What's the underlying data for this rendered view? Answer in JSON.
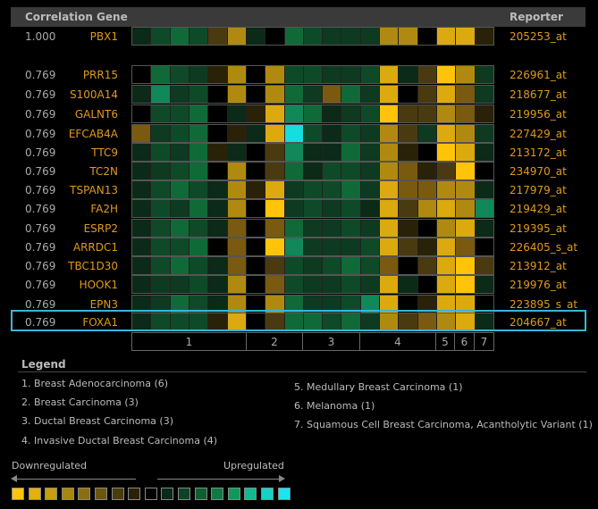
{
  "header": {
    "left": "Correlation Gene",
    "right": "Reporter"
  },
  "palette": {
    "k": "#000000",
    "g1": "#0b2a18",
    "g2": "#0d3a20",
    "g3": "#0f4a28",
    "g4": "#0f6a38",
    "g5": "#10885a",
    "c": "#15dedc",
    "y1": "#2a2208",
    "y2": "#4a3a10",
    "y3": "#7a5a10",
    "y4": "#b08a10",
    "y5": "#dcaa0e",
    "y6": "#ffc40a"
  },
  "rows": [
    {
      "corr": "1.000",
      "gene": "PBX1",
      "reporter": "205253_at",
      "cells": [
        "g1",
        "g3",
        "g4",
        "g3",
        "y2",
        "y4",
        "g1",
        "k",
        "g4",
        "g3",
        "g2",
        "g2",
        "g2",
        "y4",
        "y4",
        "k",
        "y5",
        "y5",
        "y1"
      ]
    },
    {
      "corr": "0.769",
      "gene": "PRR15",
      "reporter": "226961_at",
      "cells": [
        "k",
        "g4",
        "g3",
        "g2",
        "y1",
        "y4",
        "k",
        "y4",
        "g3",
        "g3",
        "g2",
        "g2",
        "g3",
        "y5",
        "g1",
        "y2",
        "y6",
        "y4",
        "g2"
      ]
    },
    {
      "corr": "0.769",
      "gene": "S100A14",
      "reporter": "218677_at",
      "cells": [
        "g1",
        "g5",
        "g2",
        "g3",
        "k",
        "y4",
        "k",
        "y4",
        "g4",
        "g2",
        "y3",
        "g4",
        "g2",
        "y5",
        "k",
        "y2",
        "y5",
        "y3",
        "g2"
      ]
    },
    {
      "corr": "0.769",
      "gene": "GALNT6",
      "reporter": "219956_at",
      "cells": [
        "k",
        "g3",
        "g3",
        "g4",
        "k",
        "g1",
        "y1",
        "y5",
        "g5",
        "g4",
        "g1",
        "g2",
        "g3",
        "y6",
        "y2",
        "y2",
        "y4",
        "y3",
        "y1"
      ]
    },
    {
      "corr": "0.769",
      "gene": "EFCAB4A",
      "reporter": "227429_at",
      "cells": [
        "y3",
        "g2",
        "g3",
        "g4",
        "k",
        "y1",
        "g1",
        "y5",
        "c",
        "g3",
        "g1",
        "g3",
        "g2",
        "y4",
        "y2",
        "g2",
        "y5",
        "y4",
        "g2"
      ]
    },
    {
      "corr": "0.769",
      "gene": "TTC9",
      "reporter": "213172_at",
      "cells": [
        "g1",
        "g3",
        "g2",
        "g4",
        "y1",
        "g1",
        "k",
        "y2",
        "g5",
        "g1",
        "g1",
        "g4",
        "g2",
        "y4",
        "y1",
        "k",
        "y6",
        "y5",
        "g1"
      ]
    },
    {
      "corr": "0.769",
      "gene": "TC2N",
      "reporter": "234970_at",
      "cells": [
        "g1",
        "g2",
        "g3",
        "g4",
        "k",
        "y4",
        "k",
        "y2",
        "g4",
        "g1",
        "g3",
        "g3",
        "g2",
        "y4",
        "y3",
        "y1",
        "y2",
        "y6",
        "k"
      ]
    },
    {
      "corr": "0.769",
      "gene": "TSPAN13",
      "reporter": "217979_at",
      "cells": [
        "g1",
        "g3",
        "g4",
        "g3",
        "g1",
        "y4",
        "y1",
        "y5",
        "g2",
        "g3",
        "g3",
        "g4",
        "g2",
        "y5",
        "y3",
        "y3",
        "y4",
        "y4",
        "g1"
      ]
    },
    {
      "corr": "0.769",
      "gene": "FA2H",
      "reporter": "219429_at",
      "cells": [
        "g1",
        "g3",
        "g2",
        "g4",
        "g1",
        "y4",
        "k",
        "y6",
        "g2",
        "g3",
        "g2",
        "g3",
        "g1",
        "y5",
        "y2",
        "y4",
        "y5",
        "y4",
        "g5"
      ]
    },
    {
      "corr": "0.769",
      "gene": "ESRP2",
      "reporter": "219395_at",
      "cells": [
        "g1",
        "g3",
        "g4",
        "g3",
        "g1",
        "y3",
        "k",
        "y3",
        "g4",
        "g2",
        "g2",
        "g3",
        "g2",
        "y5",
        "y1",
        "k",
        "y4",
        "y5",
        "g1"
      ]
    },
    {
      "corr": "0.769",
      "gene": "ARRDC1",
      "reporter": "226405_s_at",
      "cells": [
        "g1",
        "g3",
        "g3",
        "g4",
        "k",
        "y3",
        "k",
        "y6",
        "g5",
        "g2",
        "g2",
        "g2",
        "g3",
        "y5",
        "y2",
        "y1",
        "y5",
        "y3",
        "k"
      ]
    },
    {
      "corr": "0.769",
      "gene": "TBC1D30",
      "reporter": "213912_at",
      "cells": [
        "g1",
        "g3",
        "g4",
        "g3",
        "g1",
        "y3",
        "k",
        "y2",
        "g3",
        "g2",
        "g3",
        "g4",
        "g3",
        "y3",
        "k",
        "y2",
        "y5",
        "y6",
        "y2"
      ]
    },
    {
      "corr": "0.769",
      "gene": "HOOK1",
      "reporter": "219976_at",
      "cells": [
        "g1",
        "g2",
        "g2",
        "g3",
        "g1",
        "y4",
        "k",
        "y3",
        "g3",
        "g2",
        "g2",
        "g3",
        "g2",
        "y5",
        "g1",
        "k",
        "y5",
        "y6",
        "g1"
      ]
    },
    {
      "corr": "0.769",
      "gene": "EPN3",
      "reporter": "223895_s_at",
      "cells": [
        "g1",
        "g2",
        "g4",
        "g3",
        "g1",
        "y4",
        "k",
        "y4",
        "g4",
        "g2",
        "g2",
        "g3",
        "g5",
        "y5",
        "k",
        "y1",
        "y5",
        "y5",
        "k"
      ]
    },
    {
      "corr": "0.769",
      "gene": "FOXA1",
      "reporter": "204667_at",
      "cells": [
        "g1",
        "g3",
        "g3",
        "g3",
        "y1",
        "y5",
        "k",
        "y2",
        "g4",
        "g4",
        "g3",
        "g4",
        "g2",
        "y4",
        "y2",
        "y3",
        "y4",
        "y5",
        "g1"
      ]
    }
  ],
  "groups": [
    {
      "label": "1",
      "count": 6
    },
    {
      "label": "2",
      "count": 3
    },
    {
      "label": "3",
      "count": 3
    },
    {
      "label": "4",
      "count": 4
    },
    {
      "label": "5",
      "count": 1
    },
    {
      "label": "6",
      "count": 1
    },
    {
      "label": "7",
      "count": 1
    }
  ],
  "legend": {
    "title": "Legend",
    "items": [
      "1. Breast Adenocarcinoma (6)",
      "2. Breast Carcinoma (3)",
      "3. Ductal Breast Carcinoma (3)",
      "4. Invasive Ductal Breast Carcinoma (4)",
      "5. Medullary Breast Carcinoma (1)",
      "6. Melanoma (1)",
      "7. Squamous Cell Breast Carcinoma, Acantholytic Variant (1)"
    ]
  },
  "scale": {
    "down_label": "Downregulated",
    "up_label": "Upregulated",
    "swatches": [
      "#ffc40a",
      "#e3b00c",
      "#c89d0e",
      "#a8860f",
      "#8a6e10",
      "#6b560f",
      "#4a3c0d",
      "#2a2208",
      "#000000",
      "#0b2a18",
      "#0e4226",
      "#0f5e32",
      "#0f7a42",
      "#10985a",
      "#12b890",
      "#15d2c8",
      "#18e6f0"
    ]
  }
}
